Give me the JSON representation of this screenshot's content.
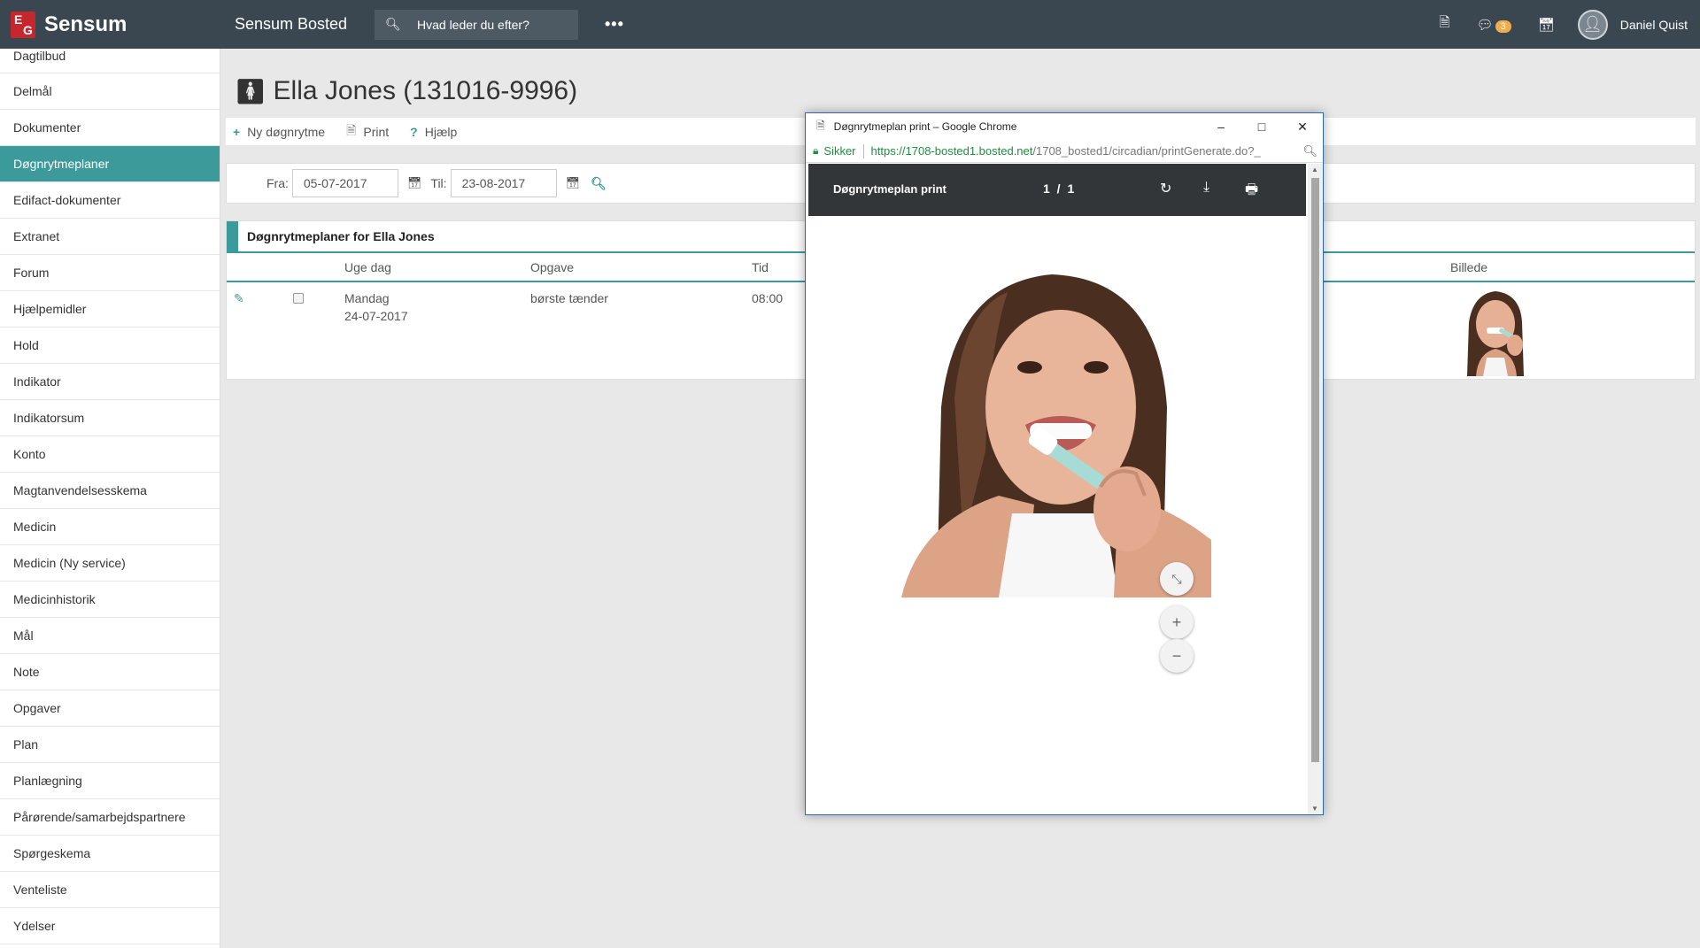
{
  "app": {
    "logo_text": "Sensum",
    "title": "Sensum Bosted"
  },
  "search": {
    "placeholder": "Hvad leder du efter?"
  },
  "topbar": {
    "messages_badge": "3",
    "username": "Daniel Quist"
  },
  "sidebar": {
    "items": [
      {
        "label": "Dagtilbud"
      },
      {
        "label": "Delmål"
      },
      {
        "label": "Dokumenter"
      },
      {
        "label": "Døgnrytmeplaner",
        "active": true
      },
      {
        "label": "Edifact-dokumenter"
      },
      {
        "label": "Extranet"
      },
      {
        "label": "Forum"
      },
      {
        "label": "Hjælpemidler"
      },
      {
        "label": "Hold"
      },
      {
        "label": "Indikator"
      },
      {
        "label": "Indikatorsum"
      },
      {
        "label": "Konto"
      },
      {
        "label": "Magtanvendelsesskema"
      },
      {
        "label": "Medicin"
      },
      {
        "label": "Medicin (Ny service)"
      },
      {
        "label": "Medicinhistorik"
      },
      {
        "label": "Mål"
      },
      {
        "label": "Note"
      },
      {
        "label": "Opgaver"
      },
      {
        "label": "Plan"
      },
      {
        "label": "Planlægning"
      },
      {
        "label": "Pårørende/samarbejdspartnere"
      },
      {
        "label": "Spørgeskema"
      },
      {
        "label": "Venteliste"
      },
      {
        "label": "Ydelser"
      }
    ]
  },
  "main": {
    "title": "Ella Jones (131016-9996)",
    "toolbar": {
      "new": "Ny døgnrytme",
      "print": "Print",
      "help": "Hjælp"
    },
    "filter": {
      "from_label": "Fra:",
      "from_value": "05-07-2017",
      "to_label": "Til:",
      "to_value": "23-08-2017"
    },
    "panel": {
      "heading": "Døgnrytmeplaner for  Ella Jones",
      "columns": {
        "weekday": "Uge dag",
        "task": "Opgave",
        "time": "Tid",
        "image": "Billede"
      },
      "row": {
        "weekday": "Mandag",
        "date": "24-07-2017",
        "task": "børste tænder",
        "time": "08:00"
      }
    }
  },
  "popup": {
    "window_title": "Døgnrytmeplan print – Google Chrome",
    "secure_label": "Sikker",
    "url_host": "https://1708-bosted1.bosted.net",
    "url_path": "/1708_bosted1/circadian/printGenerate.do?_",
    "pdf_title": "Døgnrytmeplan print",
    "pdf_page": "1 / 1"
  },
  "colors": {
    "accent": "#3d9a9b",
    "topbar": "#3a4750",
    "brand_red": "#c6262e"
  }
}
